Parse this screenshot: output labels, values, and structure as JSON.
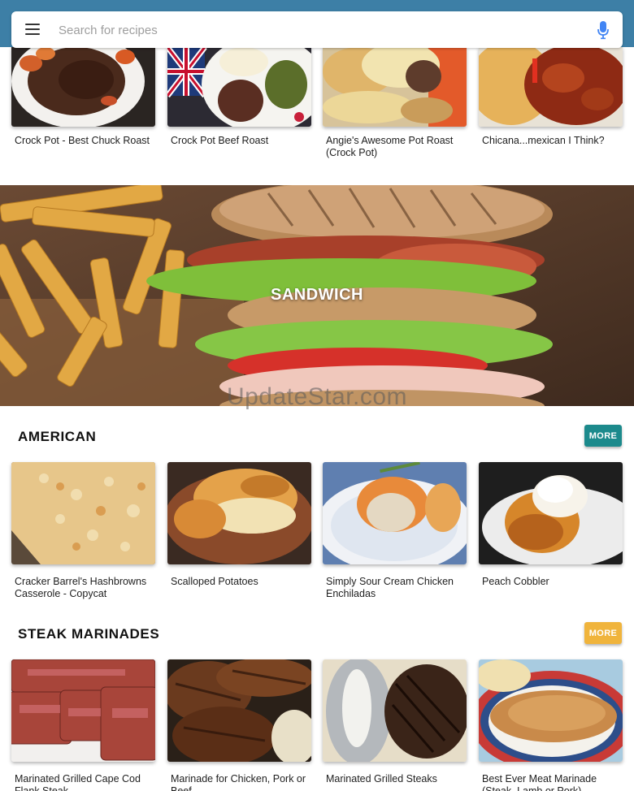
{
  "search": {
    "placeholder": "Search for recipes",
    "menu_icon": "hamburger-menu-icon",
    "mic_icon": "microphone-icon"
  },
  "top_recipes": [
    {
      "name": "Crock Pot - Best Chuck Roast"
    },
    {
      "name": "Crock Pot Beef Roast"
    },
    {
      "name": "Angie's Awesome Pot Roast (Crock Pot)"
    },
    {
      "name": "Chicana...mexican I Think?"
    }
  ],
  "banner": {
    "title": "SANDWICH"
  },
  "watermark": "UpdateStar.com",
  "sections": [
    {
      "title": "AMERICAN",
      "more_label": "MORE",
      "more_color": "#1c8a8c",
      "recipes": [
        {
          "name": "Cracker Barrel's Hashbrowns Casserole - Copycat"
        },
        {
          "name": "Scalloped Potatoes"
        },
        {
          "name": "Simply Sour Cream Chicken Enchiladas"
        },
        {
          "name": "Peach Cobbler"
        }
      ]
    },
    {
      "title": "STEAK MARINADES",
      "more_label": "MORE",
      "more_color": "#f0b43c",
      "recipes": [
        {
          "name": "Marinated Grilled Cape Cod Flank Steak"
        },
        {
          "name": "Marinade for Chicken, Pork  or Beef"
        },
        {
          "name": "Marinated Grilled Steaks"
        },
        {
          "name": "Best Ever Meat Marinade (Steak, Lamb or Pork)"
        }
      ]
    }
  ],
  "colors": {
    "header": "#3d7fa6"
  }
}
